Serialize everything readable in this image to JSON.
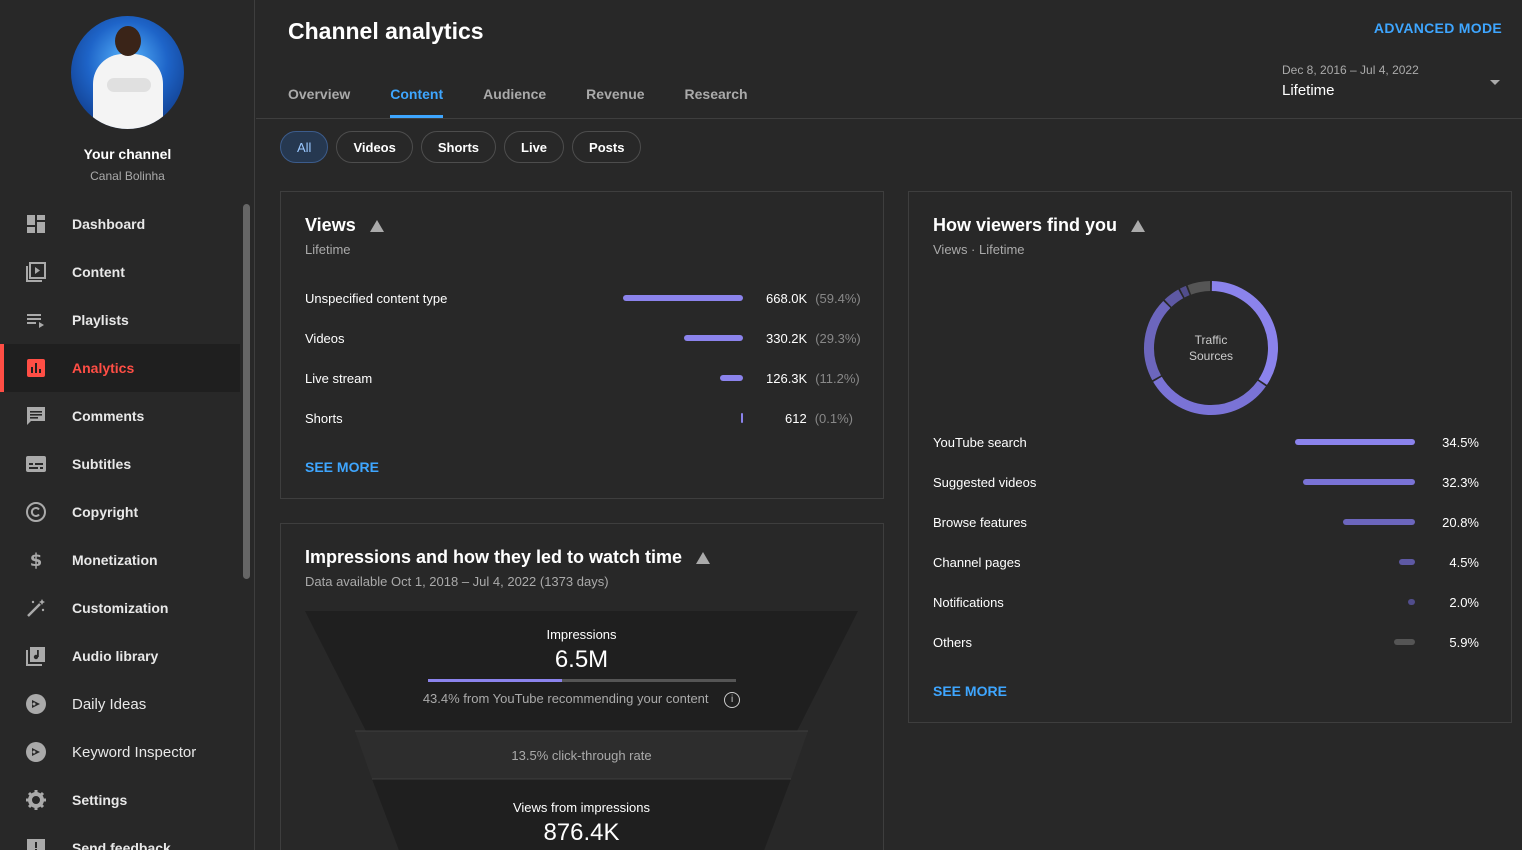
{
  "sidebar": {
    "channel_title": "Your channel",
    "channel_name": "Canal Bolinha",
    "items": [
      {
        "label": "Dashboard",
        "icon": "dashboard-icon"
      },
      {
        "label": "Content",
        "icon": "content-icon"
      },
      {
        "label": "Playlists",
        "icon": "playlists-icon"
      },
      {
        "label": "Analytics",
        "icon": "analytics-icon",
        "active": true
      },
      {
        "label": "Comments",
        "icon": "comments-icon"
      },
      {
        "label": "Subtitles",
        "icon": "subtitles-icon"
      },
      {
        "label": "Copyright",
        "icon": "copyright-icon"
      },
      {
        "label": "Monetization",
        "icon": "monetization-icon"
      },
      {
        "label": "Customization",
        "icon": "customization-icon"
      },
      {
        "label": "Audio library",
        "icon": "audio-library-icon"
      },
      {
        "label": "Daily Ideas",
        "icon": "daily-ideas-icon"
      },
      {
        "label": "Keyword Inspector",
        "icon": "keyword-inspector-icon"
      },
      {
        "label": "Settings",
        "icon": "settings-icon"
      },
      {
        "label": "Send feedback",
        "icon": "feedback-icon"
      }
    ]
  },
  "header": {
    "title": "Channel analytics",
    "advanced_mode": "ADVANCED MODE",
    "tabs": [
      {
        "label": "Overview"
      },
      {
        "label": "Content",
        "active": true
      },
      {
        "label": "Audience"
      },
      {
        "label": "Revenue"
      },
      {
        "label": "Research"
      }
    ],
    "date_range": "Dec 8, 2016 – Jul 4, 2022",
    "date_label": "Lifetime"
  },
  "chips": [
    "All",
    "Videos",
    "Shorts",
    "Live",
    "Posts"
  ],
  "views_card": {
    "title": "Views",
    "subtitle": "Lifetime",
    "see_more": "SEE MORE",
    "rows": [
      {
        "label": "Unspecified content type",
        "value": "668.0K",
        "pct": "(59.4%)",
        "share": 59.4
      },
      {
        "label": "Videos",
        "value": "330.2K",
        "pct": "(29.3%)",
        "share": 29.3
      },
      {
        "label": "Live stream",
        "value": "126.3K",
        "pct": "(11.2%)",
        "share": 11.2
      },
      {
        "label": "Shorts",
        "value": "612",
        "pct": "(0.1%)",
        "share": 0.1
      }
    ]
  },
  "impressions_card": {
    "title": "Impressions and how they led to watch time",
    "subtitle": "Data available Oct 1, 2018 – Jul 4, 2022 (1373 days)",
    "impressions_label": "Impressions",
    "impressions_value": "6.5M",
    "recommend_text": "43.4% from YouTube recommending your content",
    "recommend_share": 43.4,
    "ctr_text": "13.5% click-through rate",
    "views_label": "Views from impressions",
    "views_value": "876.4K"
  },
  "traffic_card": {
    "title": "How viewers find you",
    "subtitle": "Views · Lifetime",
    "donut_label": "Traffic Sources",
    "see_more": "SEE MORE",
    "colors": [
      "#8b83ec",
      "#7a73d6",
      "#6c66bd",
      "#5e59a4",
      "#514d8c",
      "#555555"
    ],
    "rows": [
      {
        "label": "YouTube search",
        "pct": "34.5%",
        "share": 34.5
      },
      {
        "label": "Suggested videos",
        "pct": "32.3%",
        "share": 32.3
      },
      {
        "label": "Browse features",
        "pct": "20.8%",
        "share": 20.8
      },
      {
        "label": "Channel pages",
        "pct": "4.5%",
        "share": 4.5
      },
      {
        "label": "Notifications",
        "pct": "2.0%",
        "share": 2.0
      },
      {
        "label": "Others",
        "pct": "5.9%",
        "share": 5.9
      }
    ]
  }
}
